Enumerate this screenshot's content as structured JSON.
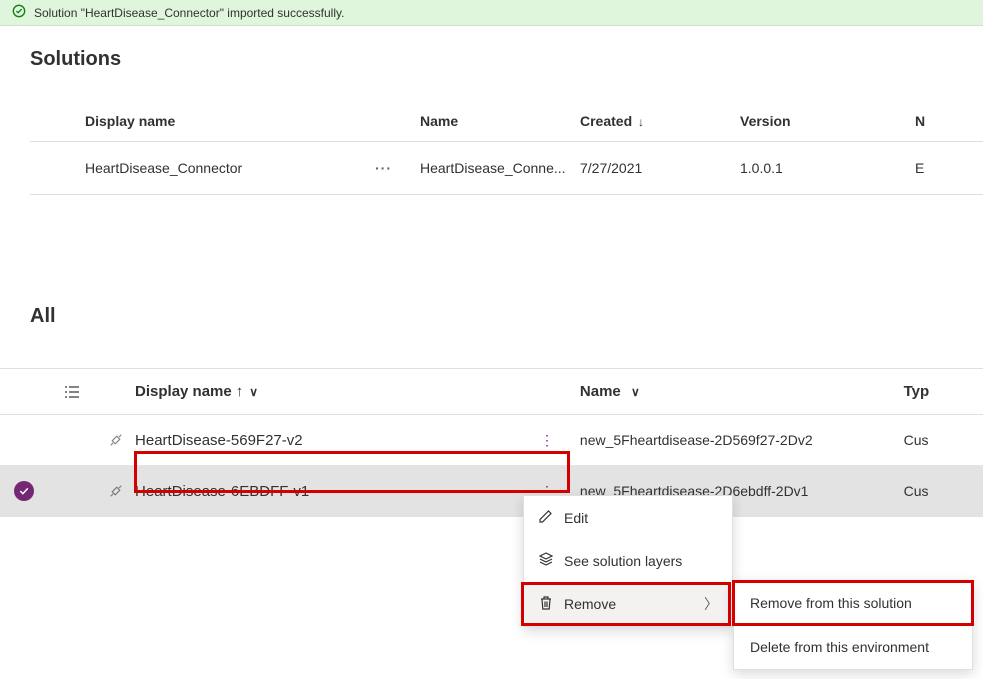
{
  "banner": {
    "message": "Solution \"HeartDisease_Connector\" imported successfully."
  },
  "solutions": {
    "title": "Solutions",
    "columns": {
      "display_name": "Display name",
      "name": "Name",
      "created": "Created",
      "version": "Version",
      "extra": "N"
    },
    "sort_arrow": "↓",
    "row": {
      "display_name": "HeartDisease_Connector",
      "name": "HeartDisease_Conne...",
      "created": "7/27/2021",
      "version": "1.0.0.1",
      "extra": "E",
      "more": "···"
    }
  },
  "all": {
    "title": "All",
    "columns": {
      "display_name": "Display name",
      "name": "Name",
      "type": "Typ"
    },
    "sort_arrow": "↑",
    "chevron": "∨",
    "rows": [
      {
        "display_name": "HeartDisease-569F27-v2",
        "name": "new_5Fheartdisease-2D569f27-2Dv2",
        "type": "Cus",
        "selected": false
      },
      {
        "display_name": "HeartDisease-6EBDFF-v1",
        "name": "new_5Fheartdisease-2D6ebdff-2Dv1",
        "type": "Cus",
        "selected": true
      }
    ],
    "vertical_dots": "⋮"
  },
  "menu": {
    "edit": "Edit",
    "layers": "See solution layers",
    "remove": "Remove",
    "arrow": "〉"
  },
  "submenu": {
    "remove_solution": "Remove from this solution",
    "delete_env": "Delete from this environment"
  }
}
